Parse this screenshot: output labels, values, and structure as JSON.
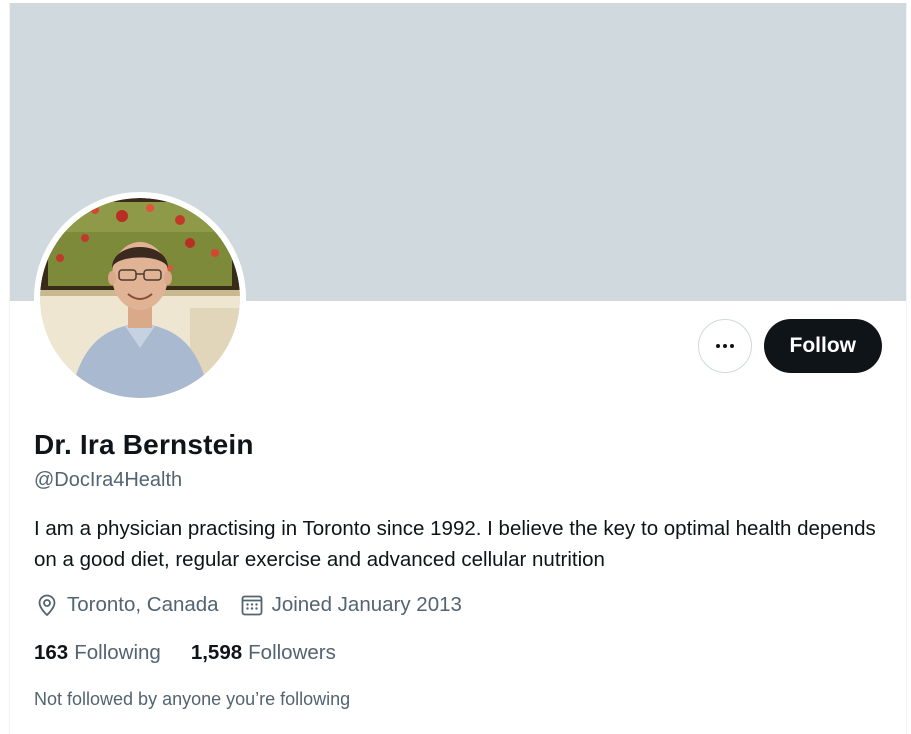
{
  "profile": {
    "display_name": "Dr. Ira Bernstein",
    "handle": "@DocIra4Health",
    "bio": "I am a physician practising in Toronto since 1992. I believe the key to optimal health depends on a good diet, regular exercise and advanced cellular nutrition",
    "location": "Toronto, Canada",
    "joined": "Joined January 2013"
  },
  "stats": {
    "following_count": "163",
    "following_label": "Following",
    "followers_count": "1,598",
    "followers_label": "Followers"
  },
  "actions": {
    "follow_label": "Follow",
    "more_icon": "more-horizontal-icon"
  },
  "social_context": "Not followed by anyone you’re following",
  "colors": {
    "banner": "#cfd9de",
    "follow_button": "#0f1419",
    "secondary_text": "#536471",
    "primary_text": "#0f1419"
  }
}
